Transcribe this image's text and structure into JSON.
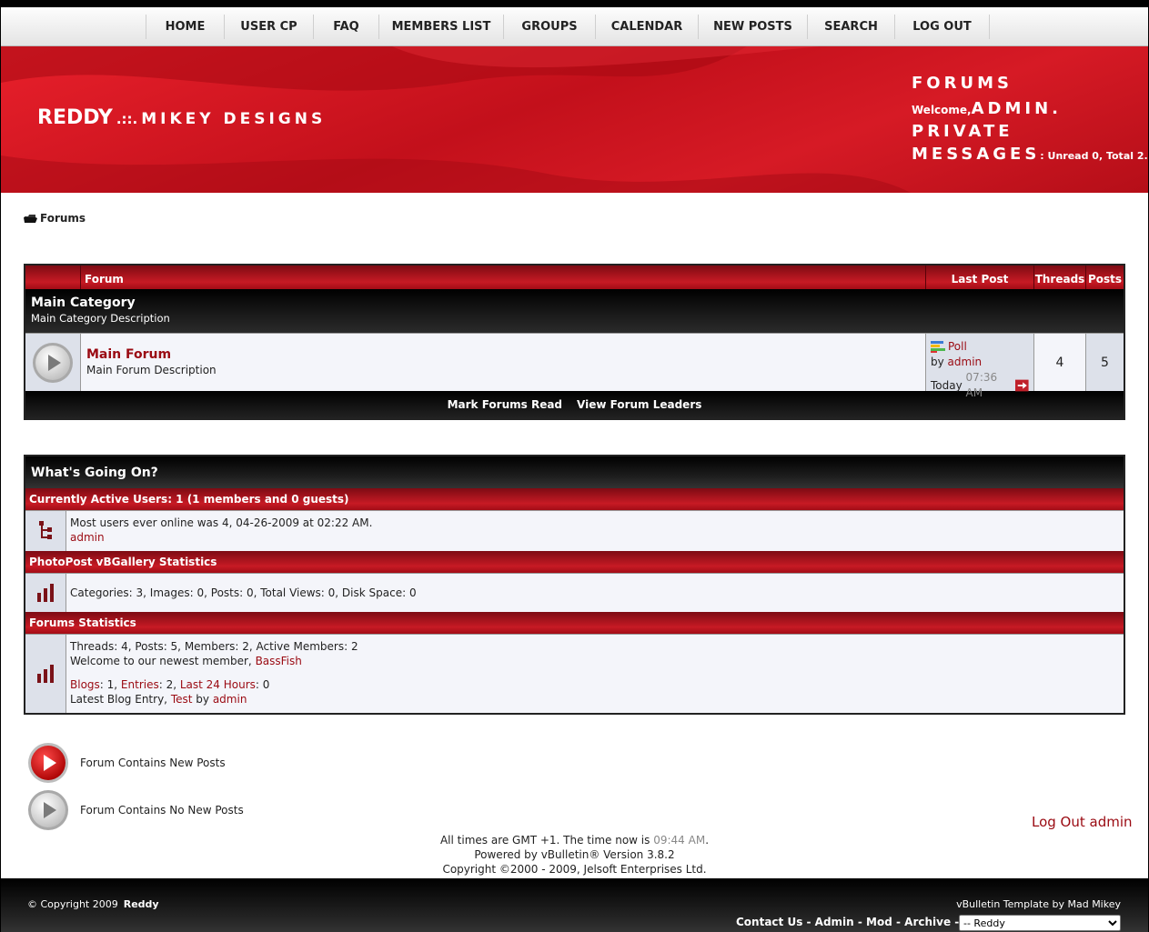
{
  "nav": {
    "items": [
      "HOME",
      "USER CP",
      "FAQ",
      "MEMBERS LIST",
      "GROUPS",
      "CALENDAR",
      "NEW POSTS",
      "SEARCH",
      "LOG OUT"
    ]
  },
  "header": {
    "logo_main": "REDDY",
    "logo_sep": ".::.",
    "logo_sub": "MIKEY DESIGNS",
    "forums": "FORUMS",
    "welcome": "Welcome,",
    "username": "ADMIN.",
    "private": "PRIVATE",
    "messages": "MESSAGES",
    "pm_status": ": Unread 0, Total 2."
  },
  "breadcrumb": {
    "label": "Forums"
  },
  "forum_table": {
    "headers": {
      "forum": "Forum",
      "last_post": "Last Post",
      "threads": "Threads",
      "posts": "Posts"
    },
    "category": {
      "title": "Main Category",
      "description": "Main Category Description"
    },
    "forum": {
      "title": "Main Forum",
      "description": "Main Forum Description",
      "last_post_title": "Poll",
      "by": "by",
      "last_post_user": "admin",
      "last_post_day": "Today",
      "last_post_time": "07:36 AM",
      "threads": "4",
      "posts": "5"
    },
    "footer": {
      "mark_read": "Mark Forums Read",
      "leaders": "View Forum Leaders"
    }
  },
  "wgo": {
    "title": "What's Going On?",
    "active_header": "Currently Active Users: 1 (1 members and 0 guests)",
    "most_users": "Most users ever online was 4, 04-26-2009 at 02:22 AM.",
    "active_user": "admin",
    "gallery_header": "PhotoPost vBGallery Statistics",
    "gallery_stats": "Categories: 3, Images: 0, Posts: 0, Total Views: 0, Disk Space: 0",
    "stats_header": "Forums Statistics",
    "stats_line": "Threads: 4, Posts: 5, Members: 2, Active Members: 2",
    "newest_prefix": "Welcome to our newest member,",
    "newest_member": "BassFish",
    "blogs_label": "Blogs",
    "blogs_val": ": 1,",
    "entries_label": "Entries",
    "entries_val": ": 2,",
    "last24_label": "Last 24 Hours",
    "last24_val": ": 0",
    "latest_prefix": "Latest Blog Entry,",
    "latest_entry": "Test",
    "latest_by": "by",
    "latest_user": "admin"
  },
  "legend": {
    "new_posts": "Forum Contains New Posts",
    "no_new_posts": "Forum Contains No New Posts"
  },
  "logout_link": "Log Out admin",
  "footer_info": {
    "time_prefix": "All times are GMT +1. The time now is",
    "time_now": "09:44 AM",
    "time_suffix": ".",
    "powered": "Powered by vBulletin® Version 3.8.2",
    "copyright": "Copyright ©2000 - 2009, Jelsoft Enterprises Ltd."
  },
  "bottom": {
    "copyright": "© Copyright 2009",
    "site": "Reddy",
    "template_credit": "vBulletin Template by Mad Mikey",
    "links": "Contact Us - Admin - Mod - Archive - Top",
    "style_selected": "-- Reddy"
  },
  "colors": {
    "accent_red": "#c71a24",
    "link_red": "#9a0a12",
    "dark": "#000000"
  }
}
